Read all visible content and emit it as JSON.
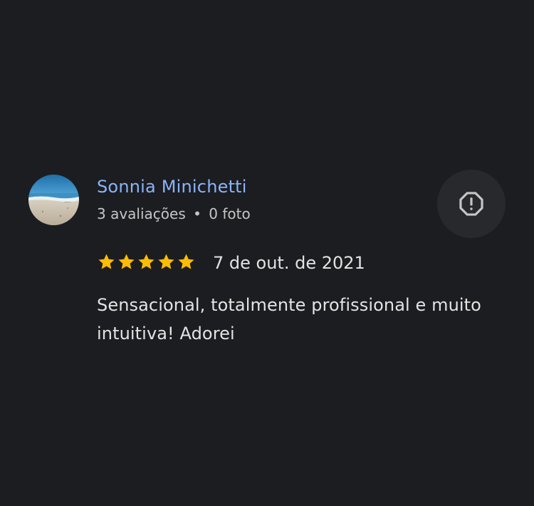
{
  "review": {
    "reviewer_name": "Sonnia Minichetti",
    "reviews_count": "3 avaliações",
    "separator": "•",
    "photos_count": "0 foto",
    "rating": 5,
    "date": "7 de out. de 2021",
    "text": "Sensacional, totalmente profissional e muito intuitiva! Adorei",
    "avatar_icon": "beach-photo",
    "flag_icon": "report-icon",
    "colors": {
      "background": "#1c1d21",
      "name": "#8ab4f8",
      "star": "#fbbc04",
      "text": "#e3e3e3"
    }
  }
}
